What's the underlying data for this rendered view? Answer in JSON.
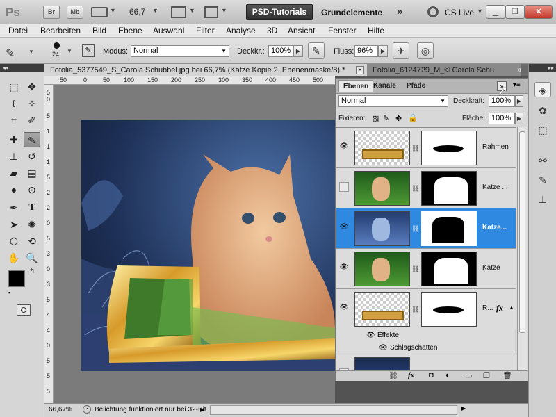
{
  "appbar": {
    "logo": "Ps",
    "bridge_btn": "Br",
    "minibridge_btn": "Mb",
    "zoom": "66,7",
    "workspace_active": "PSD-Tutorials",
    "workspace_other": "Grundelemente",
    "more": "»",
    "cs_live": "CS Live"
  },
  "menu": [
    "Datei",
    "Bearbeiten",
    "Bild",
    "Ebene",
    "Auswahl",
    "Filter",
    "Analyse",
    "3D",
    "Ansicht",
    "Fenster",
    "Hilfe"
  ],
  "options": {
    "brush_size": "24",
    "modus_label": "Modus:",
    "modus_value": "Normal",
    "deckkr_label": "Deckkr.:",
    "deckkr_value": "100%",
    "fluss_label": "Fluss:",
    "fluss_value": "96%"
  },
  "doctabs": {
    "active": "Fotolia_5377549_S_Carola Schubbel.jpg bei 66,7% (Katze Kopie 2, Ebenenmaske/8) *",
    "inactive": "Fotolia_6124729_M_© Carola Schu"
  },
  "ruler_h": [
    "50",
    "0",
    "50",
    "100",
    "150",
    "200",
    "250",
    "300",
    "350",
    "400",
    "450",
    "500"
  ],
  "ruler_v": [
    "5",
    "0",
    "5",
    "1",
    "1",
    "1",
    "5",
    "2",
    "2",
    "0",
    "5",
    "3",
    "0",
    "3",
    "5",
    "4",
    "4",
    "0",
    "5",
    "5",
    "5"
  ],
  "status": {
    "zoom": "66,67%",
    "message": "Belichtung funktioniert nur bei 32-Bit"
  },
  "panel": {
    "tabs": [
      "Ebenen",
      "Kanäle",
      "Pfade"
    ],
    "blend_mode": "Normal",
    "opacity_label": "Deckkraft:",
    "opacity_value": "100%",
    "lock_label": "Fixieren:",
    "fill_label": "Fläche:",
    "fill_value": "100%",
    "layers": [
      {
        "name": "Rahmen",
        "visible": true
      },
      {
        "name": "Katze ...",
        "visible": false
      },
      {
        "name": "Katze...",
        "visible": true,
        "selected": true
      },
      {
        "name": "Katze",
        "visible": true
      },
      {
        "name": "R...",
        "visible": true,
        "fx": "fx"
      }
    ],
    "effects_label": "Effekte",
    "shadow_label": "Schlagschatten"
  },
  "colors": {
    "selection": "#2f89e0",
    "workspace_active": "#3a3a3a"
  }
}
